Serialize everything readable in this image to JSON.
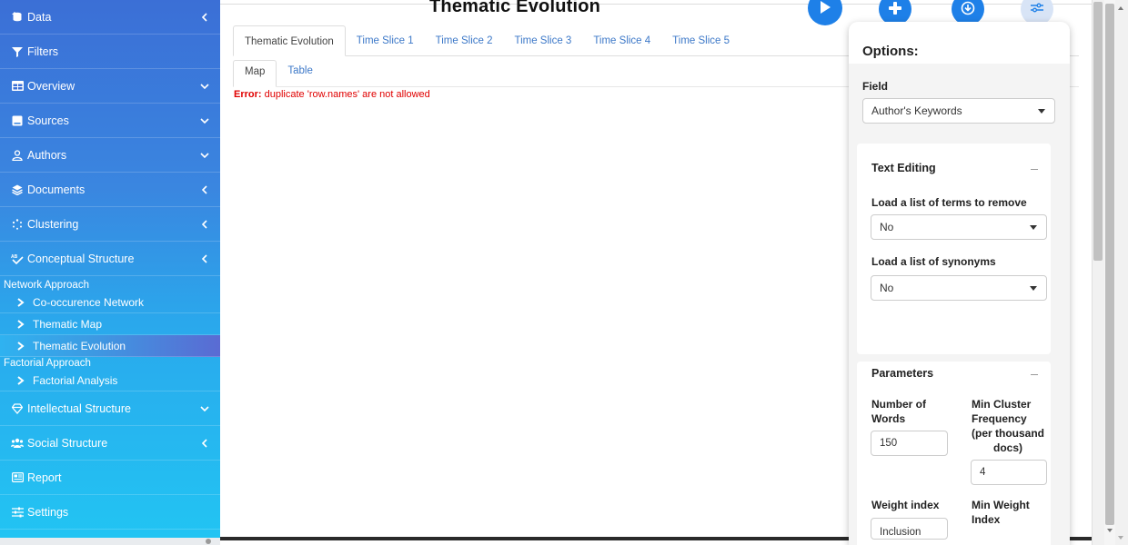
{
  "sidebar": {
    "items_top": [
      {
        "label": "Data",
        "icon": "database-upload-icon",
        "arrow": "left"
      },
      {
        "label": "Filters",
        "icon": "filter-icon",
        "arrow": "none"
      },
      {
        "label": "Overview",
        "icon": "table-icon",
        "arrow": "down"
      },
      {
        "label": "Sources",
        "icon": "book-icon",
        "arrow": "down"
      },
      {
        "label": "Authors",
        "icon": "user-icon",
        "arrow": "down"
      },
      {
        "label": "Documents",
        "icon": "layers-icon",
        "arrow": "left"
      },
      {
        "label": "Clustering",
        "icon": "spinner-icon",
        "arrow": "left"
      },
      {
        "label": "Conceptual Structure",
        "icon": "spellcheck-icon",
        "arrow": "left"
      }
    ],
    "network_header": "Network Approach",
    "network_items": [
      "Co-occurence Network",
      "Thematic Map",
      "Thematic Evolution"
    ],
    "factorial_header": "Factorial Approach",
    "factorial_items": [
      "Factorial Analysis"
    ],
    "items_bottom": [
      {
        "label": "Intellectual Structure",
        "icon": "gem-icon",
        "arrow": "down"
      },
      {
        "label": "Social Structure",
        "icon": "users-icon",
        "arrow": "left"
      },
      {
        "label": "Report",
        "icon": "newspaper-icon",
        "arrow": "none"
      },
      {
        "label": "Settings",
        "icon": "sliders-icon",
        "arrow": "none"
      }
    ],
    "active_item": "Thematic Evolution"
  },
  "header": {
    "title": "Thematic Evolution"
  },
  "tabs": [
    "Thematic Evolution",
    "Time Slice 1",
    "Time Slice 2",
    "Time Slice 3",
    "Time Slice 4",
    "Time Slice 5"
  ],
  "subtabs": [
    "Map",
    "Table"
  ],
  "error": {
    "prefix": "Error:",
    "message": "duplicate 'row.names' are not allowed"
  },
  "options": {
    "title": "Options:",
    "field_label": "Field",
    "field_value": "Author's Keywords",
    "text_editing": {
      "title": "Text Editing",
      "remove_label": "Load a list of terms to remove",
      "remove_value": "No",
      "synonyms_label": "Load a list of synonyms",
      "synonyms_value": "No"
    },
    "parameters": {
      "title": "Parameters",
      "num_words_label_1": "Number of",
      "num_words_label_2": "Words",
      "num_words_value": "150",
      "min_cluster_label_1": "Min Cluster",
      "min_cluster_label_2": "Frequency",
      "min_cluster_label_3": "(per thousand",
      "min_cluster_label_4": "docs)",
      "min_cluster_value": "4",
      "weight_index_label": "Weight index",
      "weight_index_value": "Inclusion",
      "min_weight_label_1": "Min Weight",
      "min_weight_label_2": "Index"
    }
  },
  "colors": {
    "accent": "#1e80e8",
    "error": "#e00000",
    "link": "#3c78c8"
  }
}
